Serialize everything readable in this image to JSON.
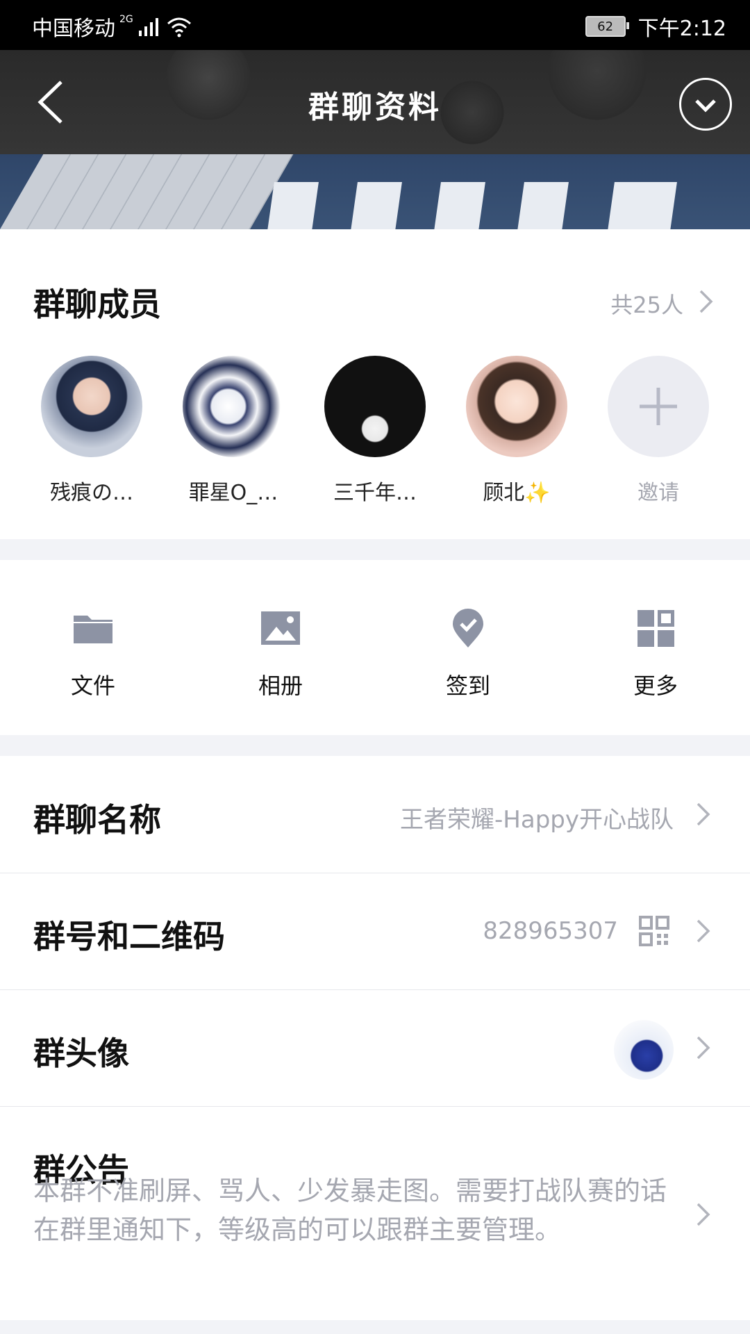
{
  "status_bar": {
    "carrier": "中国移动",
    "network": "2G",
    "battery": "62",
    "time": "下午2:12"
  },
  "header": {
    "title": "群聊资料",
    "back_icon": "chevron-left-icon",
    "more_icon": "chevron-down-circle-icon"
  },
  "members": {
    "title": "群聊成员",
    "count": "共25人",
    "items": [
      {
        "name": "残痕の…"
      },
      {
        "name": "罪星O_…"
      },
      {
        "name": "三千年…"
      },
      {
        "name": "顾北✨"
      },
      {
        "name": "邀请"
      }
    ]
  },
  "actions": [
    {
      "label": "文件",
      "icon": "folder-icon"
    },
    {
      "label": "相册",
      "icon": "image-icon"
    },
    {
      "label": "签到",
      "icon": "checkin-icon"
    },
    {
      "label": "更多",
      "icon": "grid-icon"
    }
  ],
  "rows": {
    "name_label": "群聊名称",
    "name_value": "王者荣耀-Happy开心战队",
    "number_label": "群号和二维码",
    "number_value": "828965307",
    "avatar_label": "群头像",
    "notice_label": "群公告",
    "notice_text": "本群不准刷屏、骂人、少发暴走图。需要打战队赛的话在群里通知下，等级高的可以跟群主要管理。"
  },
  "colors": {
    "accent_grey": "#a5a7b0",
    "icon_grey": "#8d93a4",
    "section_gap": "#f2f3f7"
  }
}
